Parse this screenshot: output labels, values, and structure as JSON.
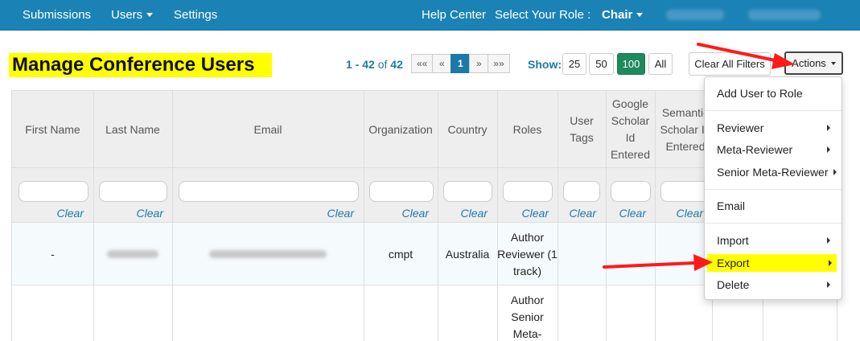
{
  "navbar": {
    "submissions": "Submissions",
    "users": "Users",
    "settings": "Settings",
    "help_center": "Help Center",
    "select_role_label": "Select Your Role :",
    "role": "Chair"
  },
  "page": {
    "title": "Manage Conference Users"
  },
  "pager": {
    "range": "1 - 42",
    "of": "of",
    "total": "42",
    "first": "««",
    "prev": "«",
    "current": "1",
    "next": "»",
    "last": "»»"
  },
  "show": {
    "label": "Show:",
    "options": [
      "25",
      "50",
      "100",
      "All"
    ],
    "selected": "100"
  },
  "toolbar": {
    "clear_filters": "Clear All Filters",
    "actions": "Actions"
  },
  "table": {
    "columns": [
      "First Name",
      "Last Name",
      "Email",
      "Organization",
      "Country",
      "Roles",
      "User Tags",
      "Google Scholar Id Entered",
      "Semantic Scholar Id Entered"
    ],
    "clear_label": "Clear",
    "rows": [
      {
        "first_name": "-",
        "organization": "cmpt",
        "country": "Australia",
        "roles": "Author Reviewer (1 track)"
      },
      {
        "roles": "Author Senior Meta-"
      }
    ]
  },
  "actions_menu": {
    "add_user_to_role": "Add User to Role",
    "reviewer": "Reviewer",
    "meta_reviewer": "Meta-Reviewer",
    "senior_meta_reviewer": "Senior Meta-Reviewer",
    "email": "Email",
    "import": "Import",
    "export": "Export",
    "delete": "Delete"
  },
  "colors": {
    "navbar": "#1b82b5",
    "highlight": "#ffff00",
    "accent": "#1b7aa8",
    "selected": "#1e8a5e",
    "arrow": "#ff1a1a"
  }
}
